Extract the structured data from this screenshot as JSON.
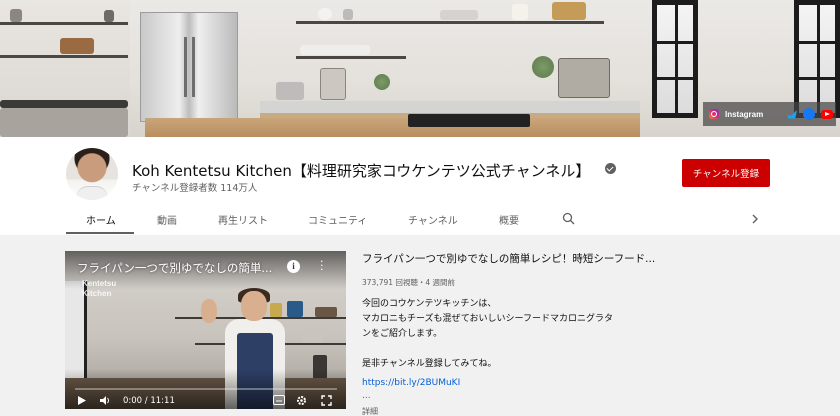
{
  "social": {
    "instagram_label": "Instagram",
    "links": [
      "twitter-icon",
      "facebook-icon",
      "youtube-icon"
    ]
  },
  "channel": {
    "name": "Koh Kentetsu Kitchen【料理研究家コウケンテツ公式チャンネル】",
    "subscribers": "チャンネル登録者数 114万人",
    "subscribe_label": "チャンネル登録",
    "verified": true
  },
  "tabs": [
    {
      "label": "ホーム",
      "active": true
    },
    {
      "label": "動画",
      "active": false
    },
    {
      "label": "再生リスト",
      "active": false
    },
    {
      "label": "コミュニティ",
      "active": false
    },
    {
      "label": "チャンネル",
      "active": false
    },
    {
      "label": "概要",
      "active": false
    }
  ],
  "featured": {
    "player_title": "フライパン一つで別ゆでなしの簡単...",
    "watermark": [
      "Kentetsu",
      "Kitchen"
    ],
    "time": "0:00 / 11:11",
    "title": "フライパン一つで別ゆでなしの簡単レシピ！時短シーフード...",
    "meta": "373,791 回視聴・4 週間前",
    "description": [
      "今回のコウケンテツキッチンは、",
      "マカロニもチーズも混ぜておいしいシーフードマカロニグラタ",
      "ンをご紹介します。",
      "",
      "是非チャンネル登録してみてね。"
    ],
    "link": "https://bit.ly/2BUMuKI",
    "ellipsis": "...",
    "more_label": "詳細"
  },
  "colors": {
    "subscribe": "#cc0000",
    "link": "#065fd4",
    "secondary_text": "#606060"
  }
}
